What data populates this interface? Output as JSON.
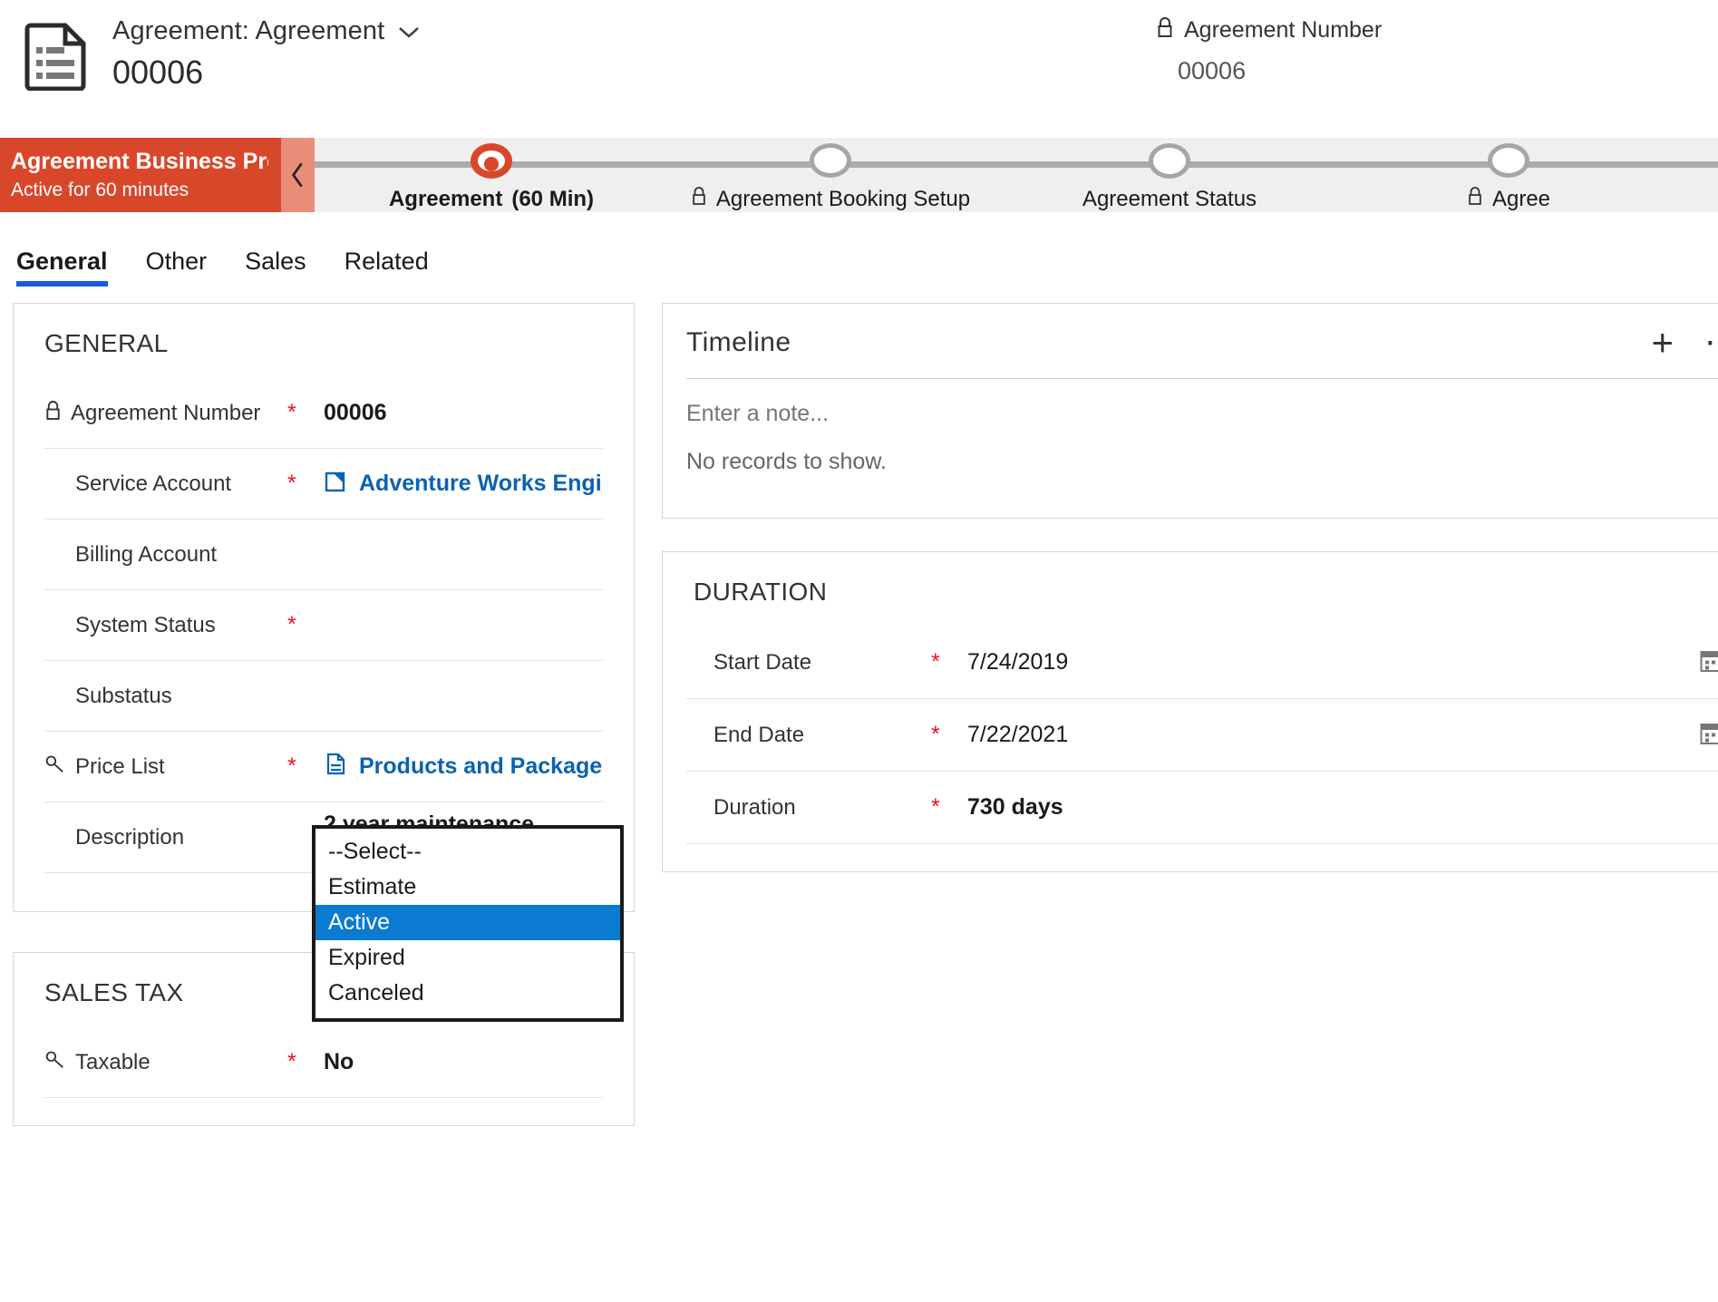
{
  "header": {
    "record_icon": "document-list-icon",
    "entity_title": "Agreement: Agreement",
    "record_name": "00006",
    "right_field_label": "Agreement Number",
    "right_field_value": "00006"
  },
  "business_process": {
    "stage_title": "Agreement Business Pro...",
    "stage_subtitle": "Active for 60 minutes",
    "bar_color": "#D9472B",
    "collapse_label": "‹",
    "stages": [
      {
        "label": "Agreement",
        "duration": "(60 Min)",
        "state": "active",
        "locked": false
      },
      {
        "label": "Agreement Booking Setup",
        "duration": "",
        "state": "pending",
        "locked": true
      },
      {
        "label": "Agreement Status",
        "duration": "",
        "state": "pending",
        "locked": false
      },
      {
        "label": "Agree",
        "duration": "",
        "state": "pending",
        "locked": true
      }
    ]
  },
  "tabs": [
    {
      "label": "General",
      "active": true
    },
    {
      "label": "Other",
      "active": false
    },
    {
      "label": "Sales",
      "active": false
    },
    {
      "label": "Related",
      "active": false
    }
  ],
  "general_section": {
    "title": "GENERAL",
    "fields": [
      {
        "label": "Agreement Number",
        "required": "*",
        "value": "00006",
        "locked": true
      },
      {
        "label": "Service Account",
        "required": "*",
        "value": "Adventure Works Enginee...",
        "link": true
      },
      {
        "label": "Billing Account",
        "required": "",
        "value": ""
      },
      {
        "label": "System Status",
        "required": "*",
        "value": ""
      },
      {
        "label": "Substatus",
        "required": "",
        "value": ""
      },
      {
        "label": "Price List",
        "required": "*",
        "value": "Products and Packaged S...",
        "link": true,
        "key": true
      },
      {
        "label": "Description",
        "required": "",
        "value": "2 year maintenance agreement"
      }
    ]
  },
  "sales_tax_section": {
    "title": "SALES TAX",
    "fields": [
      {
        "label": "Taxable",
        "required": "*",
        "value": "No",
        "key": true
      }
    ]
  },
  "dropdown": {
    "options": [
      {
        "label": "--Select--",
        "selected": false
      },
      {
        "label": "Estimate",
        "selected": false
      },
      {
        "label": "Active",
        "selected": true
      },
      {
        "label": "Expired",
        "selected": false
      },
      {
        "label": "Canceled",
        "selected": false
      }
    ],
    "highlight_color": "#0B7AD1"
  },
  "timeline": {
    "title": "Timeline",
    "add_icon": "plus-icon",
    "more_icon": "more-options-icon",
    "note_placeholder": "Enter a note...",
    "attach_icon": "paperclip-icon",
    "empty_text": "No records to show."
  },
  "duration_section": {
    "title": "DURATION",
    "fields": [
      {
        "label": "Start Date",
        "required": "*",
        "value": "7/24/2019",
        "calendar": true
      },
      {
        "label": "End Date",
        "required": "*",
        "value": "7/22/2021",
        "calendar": true
      },
      {
        "label": "Duration",
        "required": "*",
        "value": "730 days",
        "calendar": false
      }
    ]
  }
}
